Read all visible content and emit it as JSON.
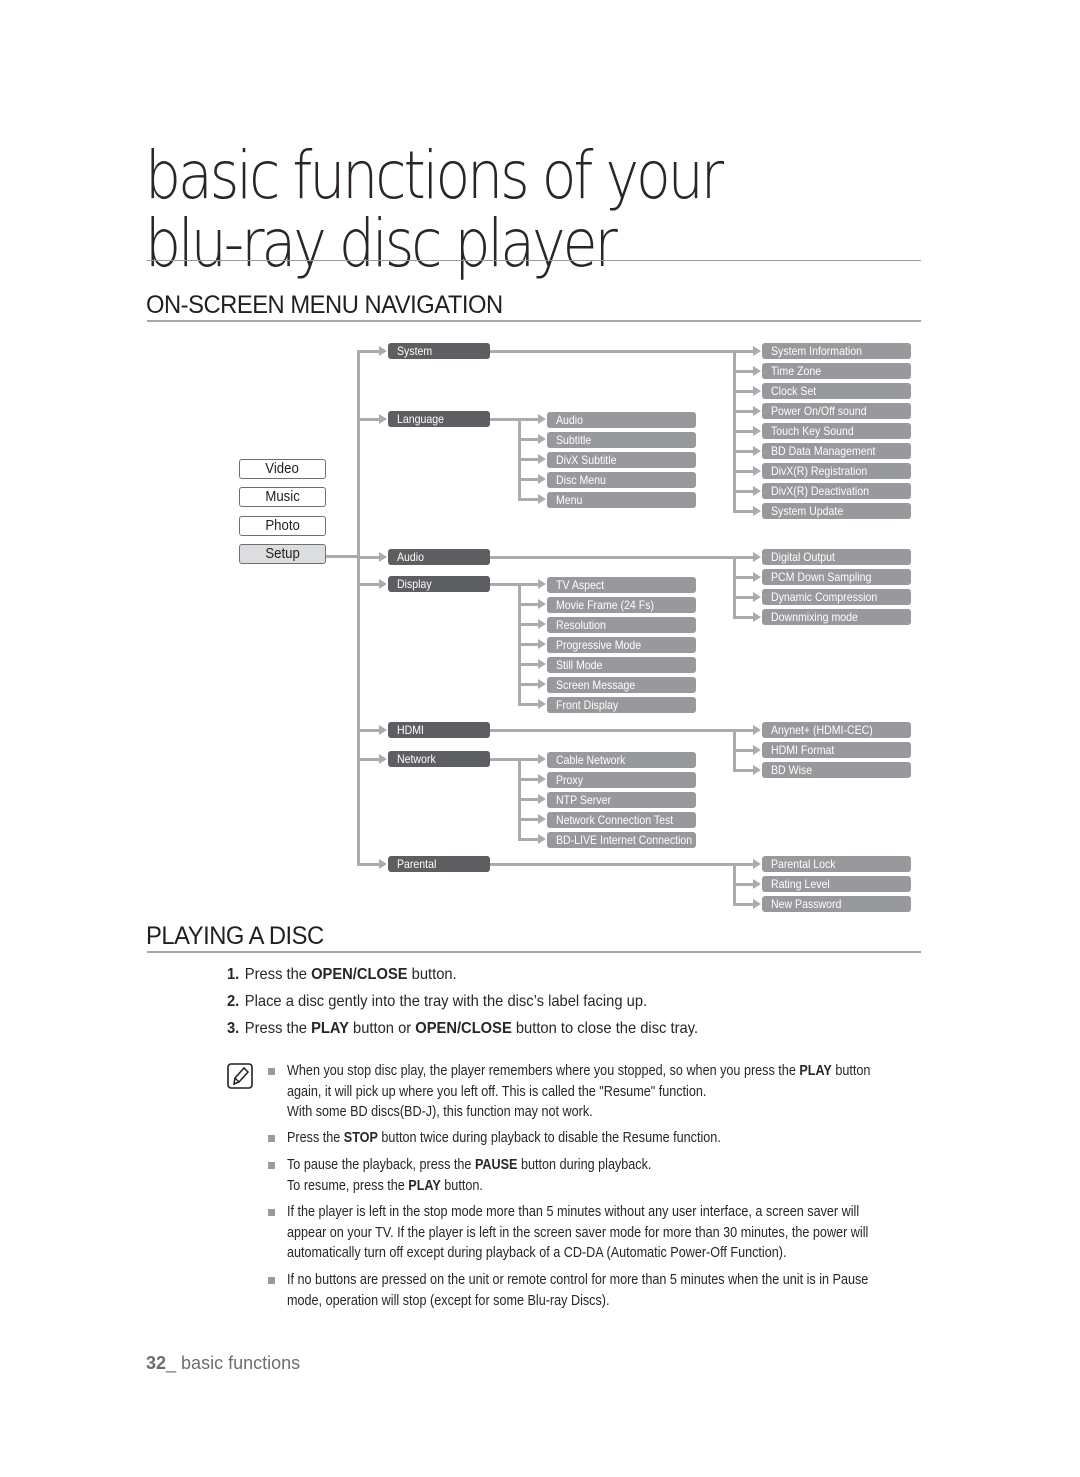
{
  "chapter": {
    "title_line1": "basic functions of your",
    "title_line2": "blu-ray disc player"
  },
  "menu_navigation": {
    "heading": "ON-SCREEN MENU NAVIGATION",
    "media_buttons": [
      {
        "label": "Video",
        "selected": false
      },
      {
        "label": "Music",
        "selected": false
      },
      {
        "label": "Photo",
        "selected": false
      },
      {
        "label": "Setup",
        "selected": true
      }
    ],
    "setup_menu": [
      {
        "label": "System",
        "children": [],
        "settings": [
          "System Information",
          "Time Zone",
          "Clock Set",
          "Power On/Off sound",
          "Touch Key Sound",
          "BD Data Management",
          "DivX(R) Registration",
          "DivX(R) Deactivation",
          "System Update"
        ]
      },
      {
        "label": "Language",
        "children": [
          "Audio",
          "Subtitle",
          "DivX Subtitle",
          "Disc Menu",
          "Menu"
        ],
        "settings": []
      },
      {
        "label": "Audio",
        "children": [],
        "settings": [
          "Digital Output",
          "PCM Down Sampling",
          "Dynamic Compression",
          "Downmixing mode"
        ]
      },
      {
        "label": "Display",
        "children": [
          "TV Aspect",
          "Movie Frame (24 Fs)",
          "Resolution",
          "Progressive Mode",
          "Still Mode",
          "Screen Message",
          "Front Display"
        ],
        "settings": []
      },
      {
        "label": "HDMI",
        "children": [],
        "settings": [
          "Anynet+ (HDMI-CEC)",
          "HDMI Format",
          "BD Wise"
        ]
      },
      {
        "label": "Network",
        "children": [
          "Cable Network",
          "Proxy",
          "NTP Server",
          "Network Connection Test",
          "BD-LIVE Internet Connection"
        ],
        "settings": []
      },
      {
        "label": "Parental",
        "children": [],
        "settings": [
          "Parental Lock",
          "Rating Level",
          "New Password"
        ]
      }
    ]
  },
  "playing_disc": {
    "heading": "PLAYING A DISC",
    "steps": [
      {
        "num": "1.",
        "pre": "Press the ",
        "bold": "OPEN/CLOSE",
        "post": " button.",
        "bold2": "",
        "post2": ""
      },
      {
        "num": "2.",
        "pre": "Place a disc gently into the tray with the disc’s label facing up.",
        "bold": "",
        "post": "",
        "bold2": "",
        "post2": ""
      },
      {
        "num": "3.",
        "pre": "Press the ",
        "bold": "PLAY",
        "post": " button or ",
        "bold2": "OPEN/CLOSE",
        "post2": " button to close the disc tray."
      }
    ],
    "notes": [
      {
        "a": "When you stop disc play, the player remembers where you stopped, so when you press the ",
        "b": "PLAY",
        "c": " button again, it will pick up where you left off. This is called the \"Resume\" function.",
        "line2": "With some BD discs(BD-J), this function may not work."
      },
      {
        "a": "Press the ",
        "b": "STOP",
        "c": " button twice during playback to disable the Resume function.",
        "line2": ""
      },
      {
        "a": "To pause the playback, press the ",
        "b": "PAUSE",
        "c": " button during playback.",
        "line2a": "To resume, press the ",
        "line2b": "PLAY",
        "line2c": " button."
      },
      {
        "a": "If the player is left in the stop mode more than 5 minutes without any user interface, a screen saver will appear on your TV. If the player is left in the screen saver mode for more than 30 minutes, the power will automatically turn off except during playback of a CD-DA (Automatic Power-Off Function).",
        "b": "",
        "c": "",
        "line2": ""
      },
      {
        "a": "If no buttons are pressed on the unit or remote control for more than 5 minutes when the unit is in Pause mode, operation will stop (except for some Blu-ray Discs).",
        "b": "",
        "c": "",
        "line2": ""
      }
    ]
  },
  "footer": {
    "page_number": "32",
    "separator": "_ ",
    "section": "basic functions"
  },
  "colors": {
    "level1_box": "#5d5e61",
    "level2_box": "#97999c",
    "connector": "#a9abae",
    "rule": "#a8a8a8"
  }
}
